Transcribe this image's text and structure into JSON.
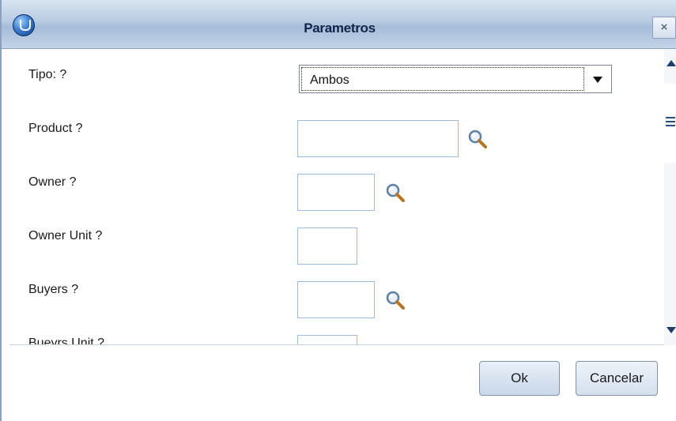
{
  "window": {
    "title": "Parametros",
    "close_label": "×",
    "icon": "app-globe-icon"
  },
  "form": {
    "tipo": {
      "label": "Tipo: ?",
      "value": "Ambos"
    },
    "product": {
      "label": "Product ?",
      "value": ""
    },
    "owner": {
      "label": "Owner ?",
      "value": ""
    },
    "owner_unit": {
      "label": "Owner Unit ?",
      "value": ""
    },
    "buyers": {
      "label": "Buyers ?",
      "value": ""
    },
    "buyers_unit": {
      "label": "Bueyrs Unit ?",
      "value": ""
    }
  },
  "buttons": {
    "ok": "Ok",
    "cancel": "Cancelar"
  }
}
